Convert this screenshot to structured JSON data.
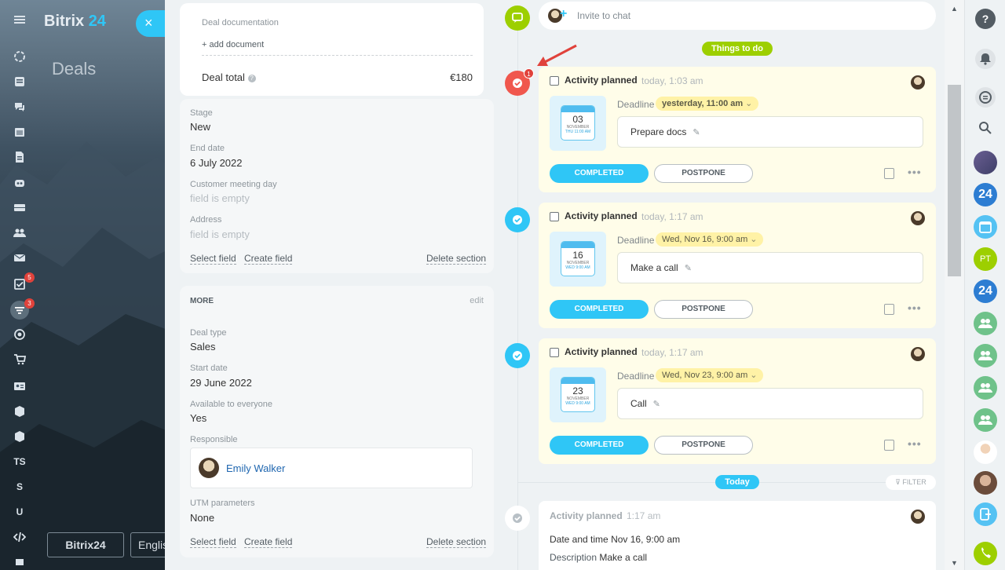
{
  "app": {
    "logo_word": "Bitrix",
    "logo_num": "24",
    "page_title": "Deals",
    "footer_logo": "Bitrix24",
    "footer_lang": "English",
    "close_icon": "×"
  },
  "leftbar": {
    "badges": [
      "5",
      "3"
    ],
    "letters": [
      "TS",
      "S",
      "U"
    ]
  },
  "deal_top": {
    "documentation_label": "Deal documentation",
    "add_document": "+ add document",
    "total_label": "Deal total",
    "total_value": "€180"
  },
  "main_section": {
    "fields": [
      {
        "label": "Stage",
        "value": "New"
      },
      {
        "label": "End date",
        "value": "6 July 2022"
      },
      {
        "label": "Customer meeting day",
        "value": "field is empty"
      },
      {
        "label": "Address",
        "value": "field is empty"
      }
    ],
    "select_field": "Select field",
    "create_field": "Create field",
    "delete_section": "Delete section"
  },
  "more_section": {
    "title": "MORE",
    "edit": "edit",
    "fields": [
      {
        "label": "Deal type",
        "value": "Sales"
      },
      {
        "label": "Start date",
        "value": "29 June 2022"
      },
      {
        "label": "Available to everyone",
        "value": "Yes"
      }
    ],
    "responsible_label": "Responsible",
    "responsible_name": "Emily Walker",
    "utm_label": "UTM parameters",
    "utm_value": "None",
    "select_field": "Select field",
    "create_field": "Create field",
    "delete_section": "Delete section"
  },
  "timeline": {
    "invite": "Invite to chat",
    "things_to_do": "Things to do",
    "counter": "1",
    "activities": [
      {
        "title": "Activity planned",
        "time": "today, 1:03 am",
        "deadline_label": "Deadline",
        "deadline": "yesterday, 11:00 am",
        "description": "Prepare docs",
        "cal_day": "03",
        "cal_month": "NOVEMBER",
        "cal_week": "THU 11:00 AM",
        "completed": "COMPLETED",
        "postpone": "POSTPONE",
        "overdue": true
      },
      {
        "title": "Activity planned",
        "time": "today, 1:17 am",
        "deadline_label": "Deadline",
        "deadline": "Wed, Nov 16, 9:00 am",
        "description": "Make a call",
        "cal_day": "16",
        "cal_month": "NOVEMBER",
        "cal_week": "WED 9:00 AM",
        "completed": "COMPLETED",
        "postpone": "POSTPONE",
        "overdue": false
      },
      {
        "title": "Activity planned",
        "time": "today, 1:17 am",
        "deadline_label": "Deadline",
        "deadline": "Wed, Nov 23, 9:00 am",
        "description": "Call",
        "cal_day": "23",
        "cal_month": "NOVEMBER",
        "cal_week": "WED 9:00 AM",
        "completed": "COMPLETED",
        "postpone": "POSTPONE",
        "overdue": false
      }
    ],
    "today": "Today",
    "filter": "FILTER",
    "history": {
      "title": "Activity planned",
      "time": "1:17 am",
      "date_label": "Date and time",
      "date_value": "Nov 16, 9:00 am",
      "desc_label": "Description",
      "desc_value": "Make a call"
    }
  },
  "rightbar": {
    "pt_initials": "PT",
    "num24": "24"
  },
  "colors": {
    "accent": "#2fc6f6",
    "overdue": "#f0574d",
    "green": "#9dcf00",
    "yellow": "#fff2a6"
  }
}
